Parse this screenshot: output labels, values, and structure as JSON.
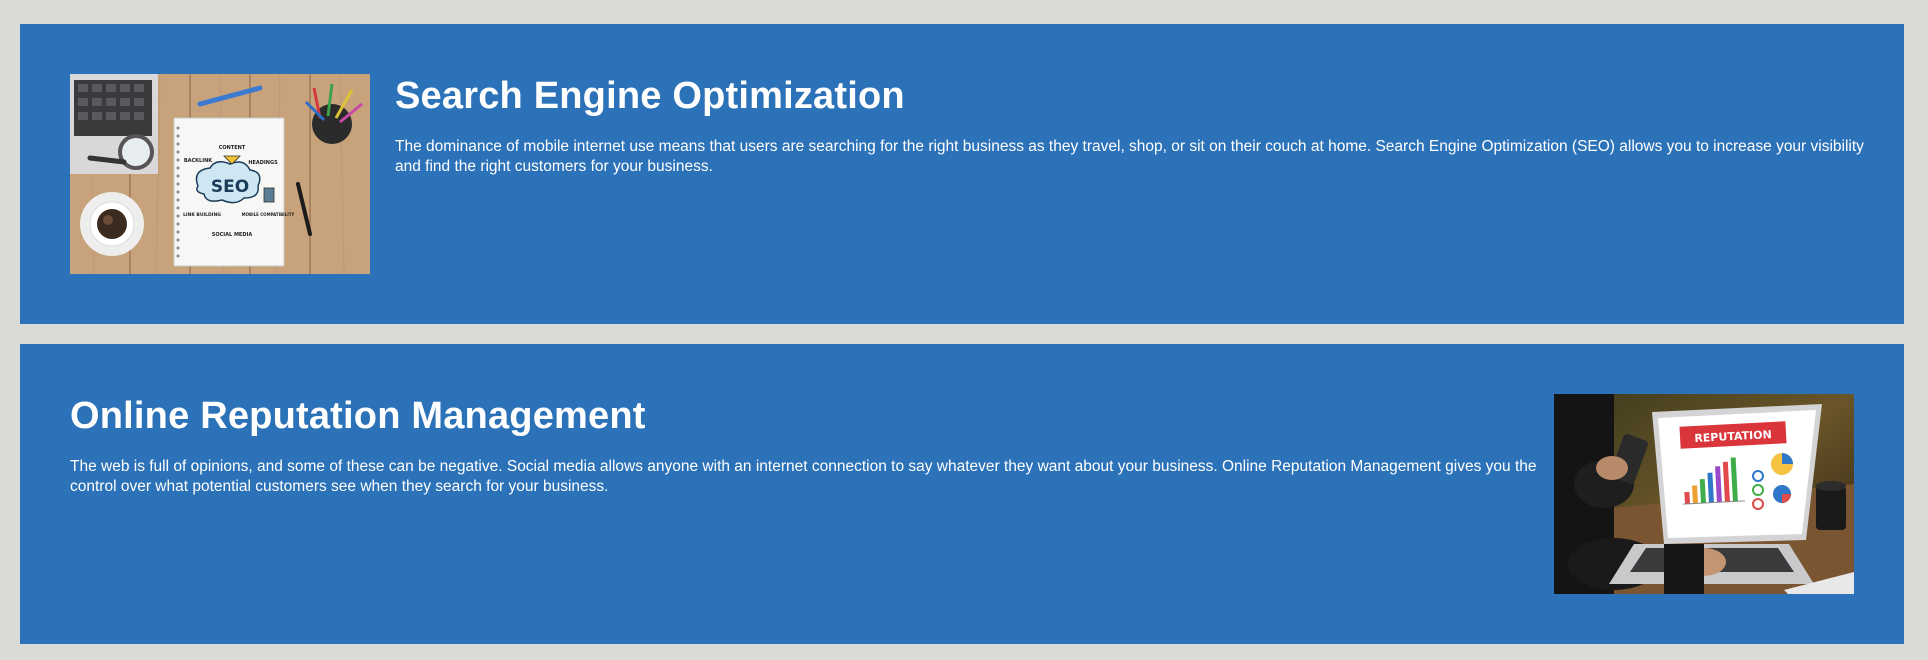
{
  "sections": [
    {
      "title": "Search Engine Optimization",
      "body": "The dominance of mobile internet use means that users are searching for the right business as they travel, shop, or sit on their couch at home. Search Engine Optimization (SEO) allows you to increase your visibility and find the right customers for your business.",
      "image": {
        "notebook_center": "SEO",
        "notebook_words": [
          "CONTENT",
          "BACKLINK",
          "HEADINGS",
          "LINK BUILDING",
          "MOBILE COMPATIBILITY",
          "SOCIAL MEDIA"
        ]
      }
    },
    {
      "title": "Online Reputation Management",
      "body": "The web is full of opinions, and some of these can be negative. Social media allows anyone with an internet connection to say whatever they want about your business. Online Reputation Management gives you the control over what potential customers see when they search for your business.",
      "image": {
        "screen_banner": "REPUTATION"
      }
    }
  ],
  "colors": {
    "page_background": "#d9dcd6",
    "section_background": "#2c72b8",
    "text": "#ffffff"
  }
}
